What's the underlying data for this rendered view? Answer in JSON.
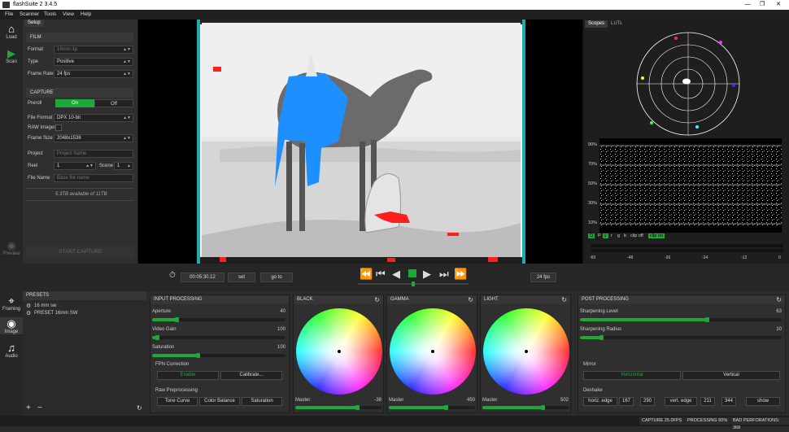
{
  "window": {
    "title": "flashSuite 2 3.4.5"
  },
  "menu": [
    "File",
    "Scanner",
    "Tools",
    "View",
    "Help"
  ],
  "left_nav": {
    "load": "Load",
    "scan": "Scan",
    "preview": "Preview"
  },
  "setup": {
    "tab": "Setup",
    "film_section": "FILM",
    "format_label": "Format",
    "format_value": "16mm-1p",
    "type_label": "Type",
    "type_value": "Positive",
    "frame_rate_label": "Frame Rate",
    "frame_rate_value": "24 fps",
    "capture_section": "CAPTURE",
    "preroll_label": "Preroll",
    "preroll_on": "On",
    "preroll_off": "Off",
    "file_format_label": "File Format",
    "file_format_value": "DPX 10-bit",
    "raw_images_label": "RAW Images",
    "frame_size_label": "Frame Size",
    "frame_size_value": "2048x1536",
    "project_label": "Project",
    "project_placeholder": "Project Name",
    "reel_label": "Reel",
    "reel_value": "1",
    "scene_label": "Scene",
    "scene_value": "1",
    "file_name_label": "File Name",
    "file_name_placeholder": "Base file name",
    "storage_info": "5.3TB available of 11TB",
    "start_capture": "START CAPTURE"
  },
  "scopes": {
    "tabs": [
      "Scopes",
      "LUTs"
    ],
    "y_labels": [
      "90%",
      "70%",
      "50%",
      "30%",
      "10%"
    ],
    "channel_buttons": [
      "Q",
      "P",
      "y",
      "r",
      "g",
      "b",
      "clip off",
      "clip on"
    ],
    "x_labels": [
      "-60",
      "-48",
      "-36",
      "-24",
      "-12",
      "0"
    ]
  },
  "transport": {
    "timecode": "00:05:30.12",
    "set": "set",
    "goto": "go to",
    "fps": "24 fps"
  },
  "bottom_nav": {
    "framing": "Framing",
    "image": "Image",
    "audio": "Audio"
  },
  "presets": {
    "title": "PRESETS",
    "items": [
      "16 mm sw",
      "PRESET 16mm SW"
    ]
  },
  "input_processing": {
    "title": "INPUT PROCESSING",
    "aperture_label": "Aperture",
    "aperture_value": "40",
    "video_gain_label": "Video Gain",
    "video_gain_value": "100",
    "saturation_label": "Saturation",
    "saturation_value": "100",
    "fpn_label": "FPN Correction",
    "enable": "Enable",
    "calibrate": "Calibrate...",
    "raw_pre_label": "Raw Preprocessing",
    "tone_curve": "Tone Curve",
    "color_balance": "Color Balance",
    "saturation_btn": "Saturation"
  },
  "wheels": [
    {
      "title": "BLACK",
      "master_label": "Master",
      "master_value": "-38"
    },
    {
      "title": "GAMMA",
      "master_label": "Master",
      "master_value": "450"
    },
    {
      "title": "LIGHT",
      "master_label": "Master",
      "master_value": "502"
    }
  ],
  "post_processing": {
    "title": "POST PROCESSING",
    "sharpening_level_label": "Sharpening Level",
    "sharpening_level_value": "63",
    "sharpening_radius_label": "Sharpening Radius",
    "sharpening_radius_value": "10",
    "mirror_label": "Mirror",
    "horizontal": "Horizontal",
    "vertical": "Vertical",
    "deshake_label": "Deshake",
    "horiz_edge": "horiz. edge",
    "h1": "167",
    "h2": "290",
    "vert_edge": "vert. edge",
    "v1": "211",
    "v2": "344",
    "show": "show"
  },
  "status": {
    "capture": "CAPTURE 25.0FPS",
    "processing": "PROCESSING 60%",
    "bad_perf": "BAD PERFORATIONS: 368"
  },
  "colors": {
    "accent_green": "#1ea83a",
    "highlight_blue": "#1e8fff",
    "clip_red": "#ff1e1e"
  }
}
